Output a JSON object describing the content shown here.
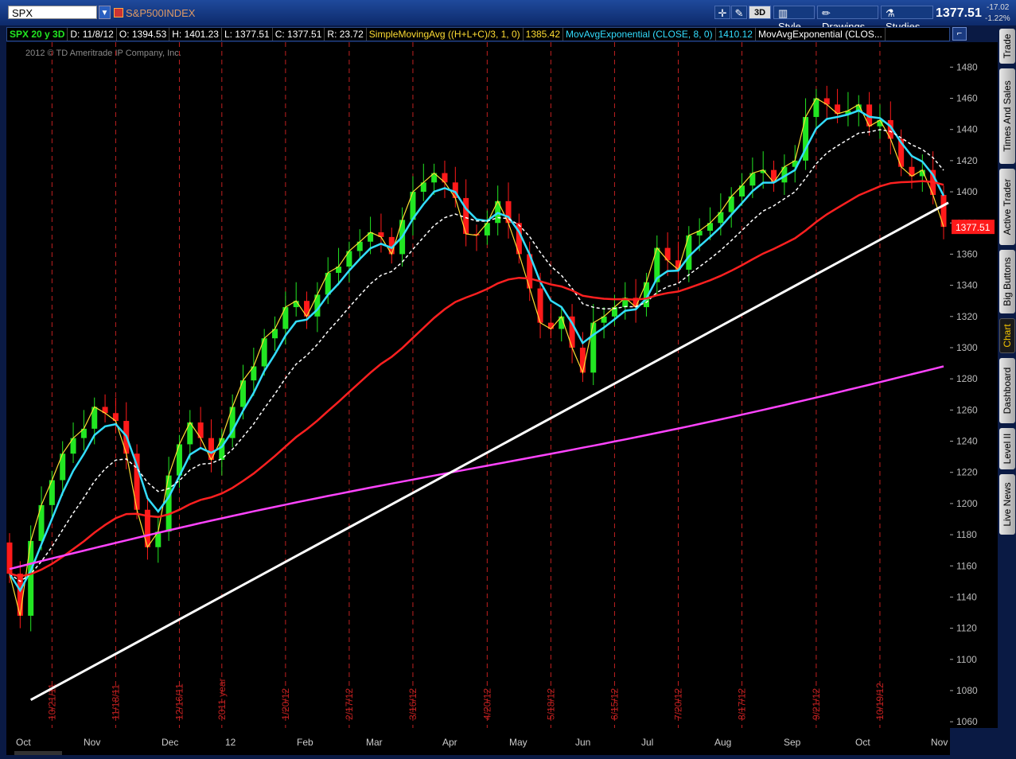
{
  "toolbar": {
    "symbol": "SPX",
    "index_name": "S&P500INDEX",
    "btn_3d": "3D",
    "btn_style": "Style",
    "btn_drawings": "Drawings",
    "btn_studies": "Studies",
    "last_price": "1377.51",
    "net_change": "-17.02",
    "pct_change": "-1.22%"
  },
  "studybar": {
    "header": "SPX 20 y 3D",
    "date": "D: 11/8/12",
    "open": "O: 1394.53",
    "high": "H: 1401.23",
    "low": "L: 1377.51",
    "close": "C: 1377.51",
    "range": "R: 23.72",
    "sma_label": "SimpleMovingAvg ((H+L+C)/3, 1, 0)",
    "sma_value": "1385.42",
    "ema1_label": "MovAvgExponential (CLOSE, 8, 0)",
    "ema1_value": "1410.12",
    "ema2_label": "MovAvgExponential (CLOS..."
  },
  "copyright": "2012 © TD Ameritrade IP Company, Inc.",
  "sidetabs": [
    "Trade",
    "Times And Sales",
    "Active Trader",
    "Big Buttons",
    "Chart",
    "Dashboard",
    "Level II",
    "Live News"
  ],
  "colors": {
    "up": "#22e622",
    "down": "#ff1a1a",
    "sma": "#ffdd33",
    "ema8": "#33ddff",
    "ma_dashed": "#ffffff",
    "ma_red": "#ff2020",
    "ma_magenta": "#ff44ff",
    "trendline": "#ffffff",
    "price_tag": "#ff1a1a"
  },
  "chart_data": {
    "type": "candlestick",
    "symbol": "SPX",
    "period": "3 day bars",
    "y_axis": {
      "ticks": [
        1060,
        1080,
        1100,
        1120,
        1140,
        1160,
        1180,
        1200,
        1220,
        1240,
        1260,
        1280,
        1300,
        1320,
        1340,
        1360,
        1380,
        1400,
        1420,
        1440,
        1460,
        1480
      ],
      "range": [
        1056,
        1496
      ]
    },
    "x_axis": {
      "months": [
        "Oct",
        "Nov",
        "Dec",
        "12",
        "Feb",
        "Mar",
        "Apr",
        "May",
        "Jun",
        "Jul",
        "Aug",
        "Sep",
        "Oct",
        "Nov"
      ],
      "week_markers": [
        "10/21/11",
        "11/18/11",
        "12/16/11",
        "2011 year",
        "1/20/12",
        "2/17/12",
        "3/16/12",
        "4/20/12",
        "5/18/12",
        "6/15/12",
        "7/20/12",
        "8/17/12",
        "9/21/12",
        "10/19/12"
      ]
    },
    "current_price_tag": "1377.51",
    "closes": [
      1155,
      1128,
      1176,
      1199,
      1215,
      1232,
      1242,
      1248,
      1262,
      1258,
      1253,
      1232,
      1196,
      1172,
      1182,
      1218,
      1238,
      1252,
      1242,
      1228,
      1242,
      1262,
      1279,
      1288,
      1306,
      1312,
      1326,
      1330,
      1320,
      1334,
      1348,
      1352,
      1362,
      1368,
      1374,
      1371,
      1360,
      1382,
      1400,
      1406,
      1412,
      1406,
      1396,
      1373,
      1372,
      1380,
      1394,
      1380,
      1360,
      1338,
      1316,
      1312,
      1320,
      1300,
      1284,
      1316,
      1320,
      1326,
      1332,
      1326,
      1342,
      1364,
      1356,
      1350,
      1372,
      1375,
      1380,
      1387,
      1397,
      1404,
      1412,
      1414,
      1406,
      1416,
      1420,
      1448,
      1460,
      1456,
      1450,
      1452,
      1456,
      1442,
      1446,
      1434,
      1416,
      1410,
      1414,
      1398,
      1377.51
    ],
    "series": [
      {
        "name": "SimpleMovingAvg ((H+L+C)/3, 1, 0)",
        "last": 1385.42
      },
      {
        "name": "MovAvgExponential (CLOSE, 8, 0)",
        "last": 1410.12
      }
    ],
    "trendline": {
      "from": [
        "10/4/11",
        1074
      ],
      "to": [
        "11/8/12",
        1393
      ]
    }
  }
}
